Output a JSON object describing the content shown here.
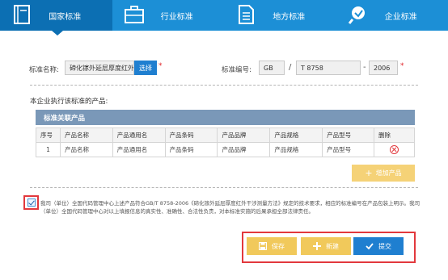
{
  "tabs": [
    {
      "label": "国家标准",
      "icon": "book-icon",
      "active": true
    },
    {
      "label": "行业标准",
      "icon": "briefcase-icon",
      "active": false
    },
    {
      "label": "地方标准",
      "icon": "document-icon",
      "active": false
    },
    {
      "label": "企业标准",
      "icon": "tools-icon",
      "active": false
    }
  ],
  "form": {
    "name_label": "标准名称:",
    "name_value": "碲化镓外延层厚度红外",
    "select_label": "选择",
    "number_label": "标准编号:",
    "number_prefix": "GB",
    "number_sep": "/",
    "number_code": "T 8758",
    "number_dash": "-",
    "number_year": "2006",
    "required_mark": "*"
  },
  "section_title": "本企业执行该标准的产品:",
  "table": {
    "caption": "标准关联产品",
    "headers": [
      "序号",
      "产品名称",
      "产品通用名",
      "产品条码",
      "产品品牌",
      "产品规格",
      "产品型号",
      "删除"
    ],
    "rows": [
      [
        "1",
        "产品名称",
        "产品通用名",
        "产品条码",
        "产品品牌",
        "产品规格",
        "产品型号"
      ]
    ]
  },
  "add_product_label": "增加产品",
  "declaration": "我司（单位）全国代码管理中心上述产品符合GB/T 8758-2006《碲化镓外延层厚度红外干涉测量方法》规定的技术要求，相应的标准编号在产品包装上明示。我司（单位）全国代码管理中心对以上填报信息的真实性、准确性、合法性负责，对本标准实施的后果承担全部法律责任。",
  "buttons": {
    "save": "保存",
    "new": "新建",
    "submit": "提交"
  },
  "colors": {
    "tab_bg": "#1c8fd6",
    "tab_active": "#0c6fb3",
    "primary": "#1f7fd0",
    "warning": "#f1c95b",
    "highlight": "#e2383d",
    "table_header": "#7a98b8"
  }
}
